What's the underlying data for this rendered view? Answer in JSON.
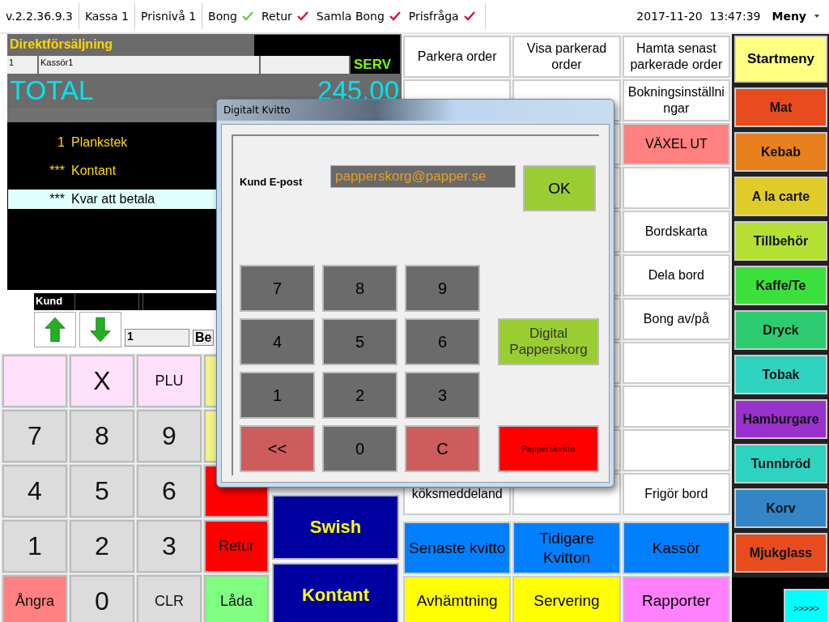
{
  "status_bar": {
    "version": "v.2.2.36.9.3",
    "register": "Kassa 1",
    "price_level": "Prisnivå 1",
    "toggles": [
      {
        "label": "Bong",
        "on": true
      },
      {
        "label": "Retur",
        "on": false
      },
      {
        "label": "Samla Bong",
        "on": false
      },
      {
        "label": "Prisfråga",
        "on": false
      }
    ],
    "datetime": "2017-11-20  13:47:39",
    "menu": "Meny"
  },
  "order_panel": {
    "title": "Direktförsäljning",
    "table_no": "1",
    "cashier": "Kassör1",
    "mode": "SERV",
    "total_label": "TOTAL",
    "total_value": "245,00",
    "lines": [
      {
        "marker": "1",
        "text": "Plankstek",
        "selected": false
      },
      {
        "marker": "***",
        "text": "Kontant",
        "selected": false
      },
      {
        "marker": "***",
        "text": "Kvar att betala",
        "selected": true
      }
    ],
    "customer_label": "Kund",
    "quantity": "1",
    "field_2": "Be"
  },
  "keypad": [
    {
      "color": "#ffe0fb"
    },
    {
      "label": "X",
      "color": "#ffe0fb"
    },
    {
      "label": "PLU",
      "color": "#ffe0fb"
    },
    {
      "color": "#f2f28a"
    },
    {
      "label": "7",
      "color": "#dcdcdc"
    },
    {
      "label": "8",
      "color": "#dcdcdc"
    },
    {
      "label": "9",
      "color": "#dcdcdc"
    },
    {
      "color": "#f2f28a"
    },
    {
      "label": "4",
      "color": "#dcdcdc"
    },
    {
      "label": "5",
      "color": "#dcdcdc"
    },
    {
      "label": "6",
      "color": "#dcdcdc"
    },
    {
      "color": "#ff0000"
    },
    {
      "label": "1",
      "color": "#dcdcdc"
    },
    {
      "label": "2",
      "color": "#dcdcdc"
    },
    {
      "label": "3",
      "color": "#dcdcdc"
    },
    {
      "label": "Retur",
      "color": "#ff0000"
    },
    {
      "label": "Ångra",
      "color": "#ff8080"
    },
    {
      "label": "0",
      "color": "#dcdcdc"
    },
    {
      "label": "CLR",
      "color": "#dcdcdc"
    },
    {
      "label": "Låda",
      "color": "#80ff80"
    }
  ],
  "payment_buttons": [
    "Swish",
    "Kontant"
  ],
  "function_grid": {
    "upper": [
      {
        "col_1": {
          "label": "Parkera order",
          "color": "#ffffff"
        },
        "col_2": {
          "label": "Visa parkerad order",
          "color": "#ffffff"
        },
        "col_3": {
          "label": "Hamta senast parkerade order",
          "color": "#ffffff"
        }
      },
      {
        "col_3": {
          "label": "Bokningsinställningar",
          "color": "#ffffff"
        }
      },
      {
        "col_3": {
          "label": "VÄXEL UT",
          "color": "#ff8080"
        }
      },
      {
        "col_3": {
          "color": "#ffffff"
        }
      },
      {
        "col_3": {
          "label": "Bordskarta",
          "color": "#ffffff"
        }
      },
      {
        "col_3": {
          "label": "Dela bord",
          "color": "#ffffff"
        }
      },
      {
        "col_3": {
          "label": "Bong av/på",
          "color": "#ffffff"
        }
      },
      {
        "col_3": {
          "color": "#ffffff"
        }
      },
      {
        "col_3": {
          "color": "#ffffff"
        }
      },
      {
        "col_3": {
          "color": "#ffffff"
        }
      },
      {
        "col_1": {
          "label": "köksmeddeland",
          "color": "#ffffff"
        },
        "col_2": {
          "color": "#ffffff"
        },
        "col_3": {
          "label": "Frigör bord",
          "color": "#ffffff"
        }
      }
    ],
    "lower": [
      {
        "label": "Senaste kvitto",
        "color": "#0080ff"
      },
      {
        "label": "Tidigare Kvitton",
        "color": "#0080ff"
      },
      {
        "label": "Kassör",
        "color": "#0080ff"
      },
      {
        "label": "Avhämtning",
        "color": "#ffff00"
      },
      {
        "label": "Servering",
        "color": "#ffff00"
      },
      {
        "label": "Rapporter",
        "color": "#ff80ff"
      }
    ]
  },
  "home_button": {
    "label": "Startmeny",
    "color": "#ffff80"
  },
  "categories": [
    {
      "label": "Mat",
      "color": "#e84c1e"
    },
    {
      "label": "Kebab",
      "color": "#e8801e"
    },
    {
      "label": "A la carte",
      "color": "#e0cc28"
    },
    {
      "label": "Tillbehör",
      "color": "#b4e034"
    },
    {
      "label": "Kaffe/Te",
      "color": "#3ce03c"
    },
    {
      "label": "Dryck",
      "color": "#2ecc71"
    },
    {
      "label": "Tobak",
      "color": "#2ed3c0"
    },
    {
      "label": "Hamburgare",
      "color": "#9932cc"
    },
    {
      "label": "Tunnbröd",
      "color": "#2ed3c0"
    },
    {
      "label": "Korv",
      "color": "#3385c6"
    },
    {
      "label": "Mjukglass",
      "color": "#e84c1e"
    }
  ],
  "next_page": ">>>>>",
  "dialog": {
    "title": "Digitalt Kvitto",
    "email_label": "Kund E-post",
    "email_value": "papperskorg@papper.se",
    "ok": "OK",
    "keys": [
      {
        "label": "7",
        "kind": "digit"
      },
      {
        "label": "8",
        "kind": "digit"
      },
      {
        "label": "9",
        "kind": "digit"
      },
      {
        "label": "4",
        "kind": "digit"
      },
      {
        "label": "5",
        "kind": "digit"
      },
      {
        "label": "6",
        "kind": "digit"
      },
      {
        "label": "1",
        "kind": "digit"
      },
      {
        "label": "2",
        "kind": "digit"
      },
      {
        "label": "3",
        "kind": "digit"
      },
      {
        "label": "<<",
        "kind": "erase"
      },
      {
        "label": "0",
        "kind": "digit"
      },
      {
        "label": "C",
        "kind": "erase"
      }
    ],
    "digital_button": "Digital Papperskorg",
    "paper_button": "Papperskvitto"
  }
}
